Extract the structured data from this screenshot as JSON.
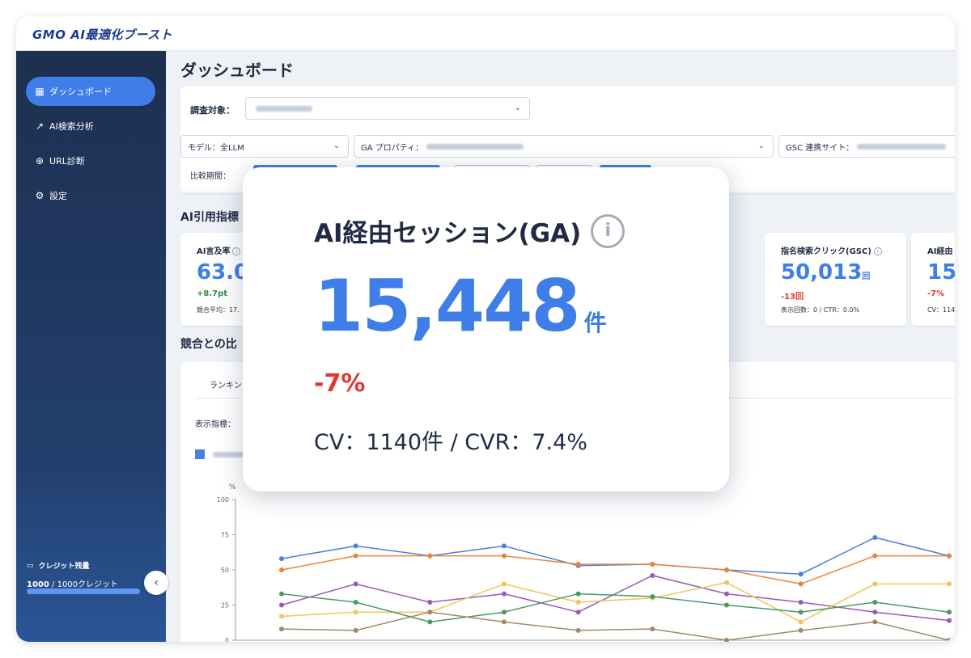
{
  "app": {
    "logo": "GMO AI最適化ブースト"
  },
  "sidebar": {
    "items": [
      {
        "label": "ダッシュボード",
        "icon": "dashboard-icon",
        "active": true
      },
      {
        "label": "AI検索分析",
        "icon": "chart-icon",
        "active": false
      },
      {
        "label": "URL診断",
        "icon": "globe-icon",
        "active": false
      },
      {
        "label": "設定",
        "icon": "gear-icon",
        "active": false
      }
    ],
    "credit": {
      "title": "クレジット残量",
      "value": "1000",
      "total": "/ 1000クレジット",
      "fraction": 1.0
    },
    "collapse_icon": "chevron-left-icon"
  },
  "main": {
    "title": "ダッシュボード",
    "filters": {
      "target_label": "調査対象：",
      "model": "モデル：全LLM",
      "ga_property": "GA プロパティ：",
      "gsc_site": "GSC 連携サイト：",
      "period_label": "比較期間："
    },
    "metrics_title": "AI引用指標",
    "cards": [
      {
        "title": "AI言及率",
        "value": "63.0",
        "delta": "+8.7pt",
        "sub": "競合平均：17."
      },
      {
        "title": "指名検索クリック(GSC)",
        "value": "50,013",
        "unit": "回",
        "delta": "-13回",
        "sub": "表示回数：0 / CTR：0.0%"
      },
      {
        "title": "AI経由",
        "value": "15",
        "delta": "-7%",
        "sub": "CV：114"
      }
    ],
    "compare_title": "競合との比",
    "tab_label": "ランキン",
    "display_metric_label": "表示指標：",
    "chart_unit": "%"
  },
  "popup": {
    "title": "AI経由セッション(GA)",
    "value": "15,448",
    "unit": "件",
    "delta": "-7%",
    "sub": "CV：1140件 / CVR：7.4%"
  },
  "chart_data": {
    "type": "line",
    "ylim": [
      0,
      100
    ],
    "yticks": [
      "0",
      "25",
      "50",
      "75",
      "100"
    ],
    "series": [
      {
        "color": "#4a7fe0",
        "values": [
          58,
          67,
          60,
          67,
          53,
          54,
          50,
          47,
          73,
          60
        ]
      },
      {
        "color": "#e8843c",
        "values": [
          50,
          60,
          60,
          60,
          54,
          54,
          50,
          40,
          60,
          60
        ]
      },
      {
        "color": "#9a58b8",
        "values": [
          25,
          40,
          27,
          33,
          20,
          46,
          33,
          27,
          20,
          14
        ]
      },
      {
        "color": "#f0c65a",
        "values": [
          17,
          20,
          20,
          40,
          27,
          30,
          41,
          13,
          40,
          40
        ]
      },
      {
        "color": "#4a9a66",
        "values": [
          33,
          27,
          13,
          20,
          33,
          31,
          25,
          20,
          27,
          20
        ]
      },
      {
        "color": "#a08968",
        "values": [
          8,
          7,
          20,
          13,
          7,
          8,
          0,
          7,
          13,
          0
        ]
      }
    ]
  }
}
